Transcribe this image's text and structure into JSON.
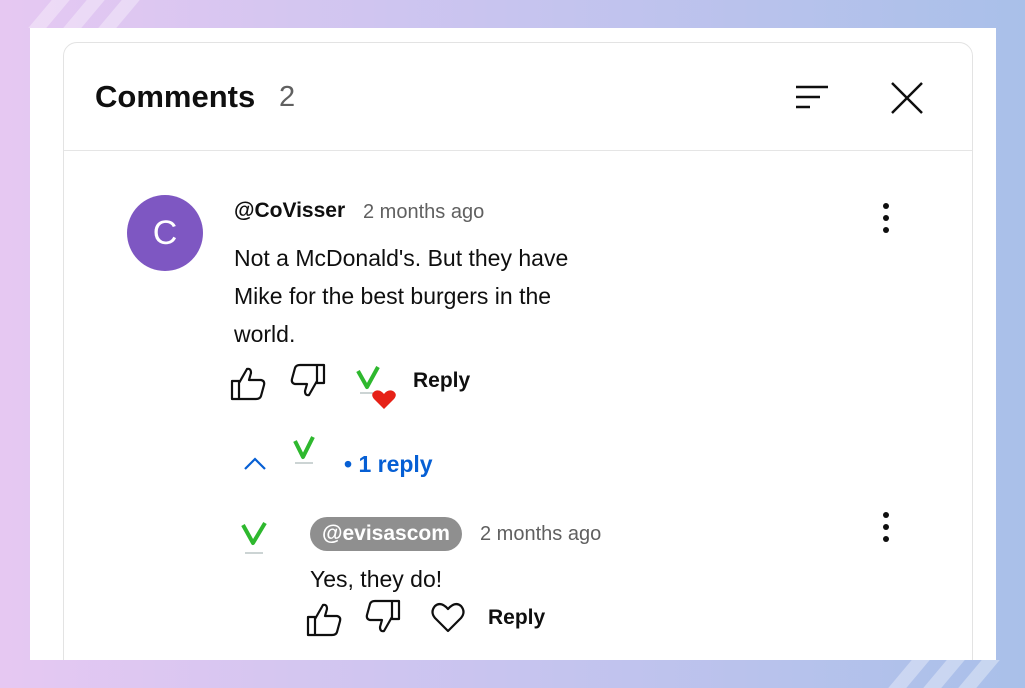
{
  "header": {
    "title": "Comments",
    "count": "2"
  },
  "comment": {
    "avatar_letter": "C",
    "author": "@CoVisser",
    "time": "2 months ago",
    "text": "Not a McDonald's. But they have Mike for the best burgers in the world.",
    "reply_label": "Reply",
    "replies_label": "• 1 reply"
  },
  "reply": {
    "author": "@evisascom",
    "time": "2 months ago",
    "text": "Yes, they do!",
    "reply_label": "Reply"
  },
  "colors": {
    "avatar": "#7e57c2",
    "link_blue": "#065fd4",
    "heart_red": "#e62117",
    "logo_green": "#2eb82e"
  }
}
